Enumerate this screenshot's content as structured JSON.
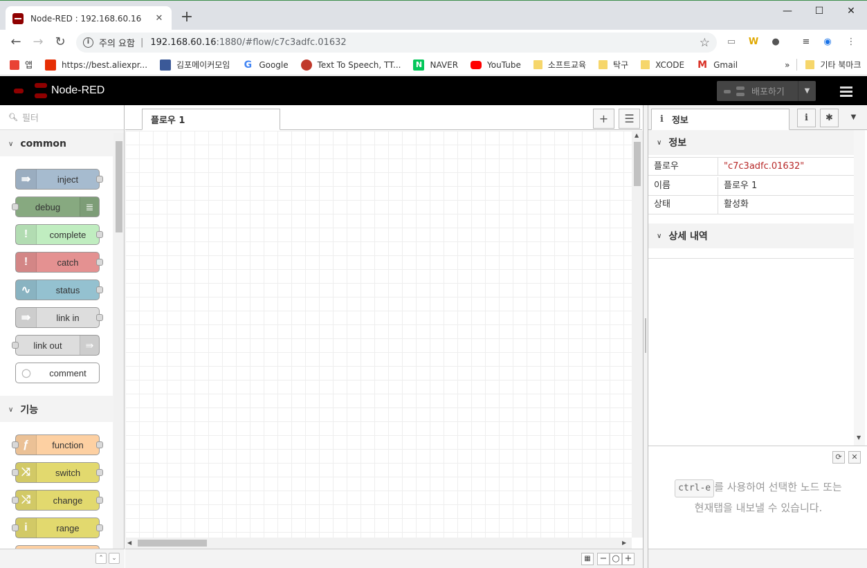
{
  "browser": {
    "tab_title": "Node-RED : 192.168.60.16",
    "tab_close": "✕",
    "new_tab": "+",
    "win_min": "—",
    "win_max": "☐",
    "win_close": "✕",
    "security_warning": "주의 요함",
    "url_host": "192.168.60.16",
    "url_path": ":1880/#flow/c7c3adfc.01632",
    "bookmarks": [
      {
        "label": "앱",
        "icon": "apps-grid-icon",
        "color": "#e94235"
      },
      {
        "label": "https://best.aliexpr...",
        "icon": "aliexpress-icon",
        "color": "#e62e04"
      },
      {
        "label": "김포메이커모임",
        "icon": "facebook-icon",
        "color": "#3b5998"
      },
      {
        "label": "Google",
        "icon": "google-icon",
        "color": "#4285f4"
      },
      {
        "label": "Text To Speech, TT...",
        "icon": "tts-icon",
        "color": "#c0392b"
      },
      {
        "label": "NAVER",
        "icon": "naver-icon",
        "color": "#03c75a"
      },
      {
        "label": "YouTube",
        "icon": "youtube-icon",
        "color": "#ff0000"
      },
      {
        "label": "소프트교육",
        "icon": "folder-icon",
        "color": "#f6d66b"
      },
      {
        "label": "탁구",
        "icon": "folder-icon",
        "color": "#f6d66b"
      },
      {
        "label": "XCODE",
        "icon": "folder-icon",
        "color": "#f6d66b"
      },
      {
        "label": "Gmail",
        "icon": "gmail-icon",
        "color": "#d93025"
      }
    ],
    "more_bookmarks": "»",
    "other_bookmarks": "기타 북마크"
  },
  "header": {
    "app_title": "Node-RED",
    "deploy_label": "배포하기"
  },
  "palette": {
    "filter_placeholder": "필터",
    "categories": [
      {
        "title": "common",
        "nodes": [
          {
            "label": "inject",
            "color": "#a6bbcf",
            "icon": "⇛"
          },
          {
            "label": "debug",
            "color": "#87a980",
            "icon": "≣"
          },
          {
            "label": "complete",
            "color": "#c0edc0",
            "icon": "!"
          },
          {
            "label": "catch",
            "color": "#e49191",
            "icon": "!"
          },
          {
            "label": "status",
            "color": "#94c1d0",
            "icon": "∿"
          },
          {
            "label": "link in",
            "color": "#dddddd",
            "icon": "⇛"
          },
          {
            "label": "link out",
            "color": "#dddddd",
            "icon": "⇛"
          },
          {
            "label": "comment",
            "color": "#ffffff",
            "icon": "💬"
          }
        ]
      },
      {
        "title": "기능",
        "nodes": [
          {
            "label": "function",
            "color": "#fdd0a2",
            "icon": "ƒ"
          },
          {
            "label": "switch",
            "color": "#e2d96e",
            "icon": "⤨"
          },
          {
            "label": "change",
            "color": "#e2d96e",
            "icon": "⤭"
          },
          {
            "label": "range",
            "color": "#e2d96e",
            "icon": "i"
          }
        ]
      }
    ]
  },
  "workspace": {
    "tab_label": "플로우 1",
    "add_button": "+",
    "list_button": "☰"
  },
  "sidebar": {
    "tab_label": "정보",
    "info_section": "정보",
    "details_section": "상세 내역",
    "rows": [
      {
        "key": "플로우",
        "value": "\"c7c3adfc.01632\""
      },
      {
        "key": "이름",
        "value": "플로우 1"
      },
      {
        "key": "상태",
        "value": "활성화"
      }
    ],
    "tip_kbd": "ctrl-e",
    "tip_text_1": "를 사용하여 선택한 노드 또는",
    "tip_text_2": "현재탭을 내보낼 수 있습니다."
  }
}
